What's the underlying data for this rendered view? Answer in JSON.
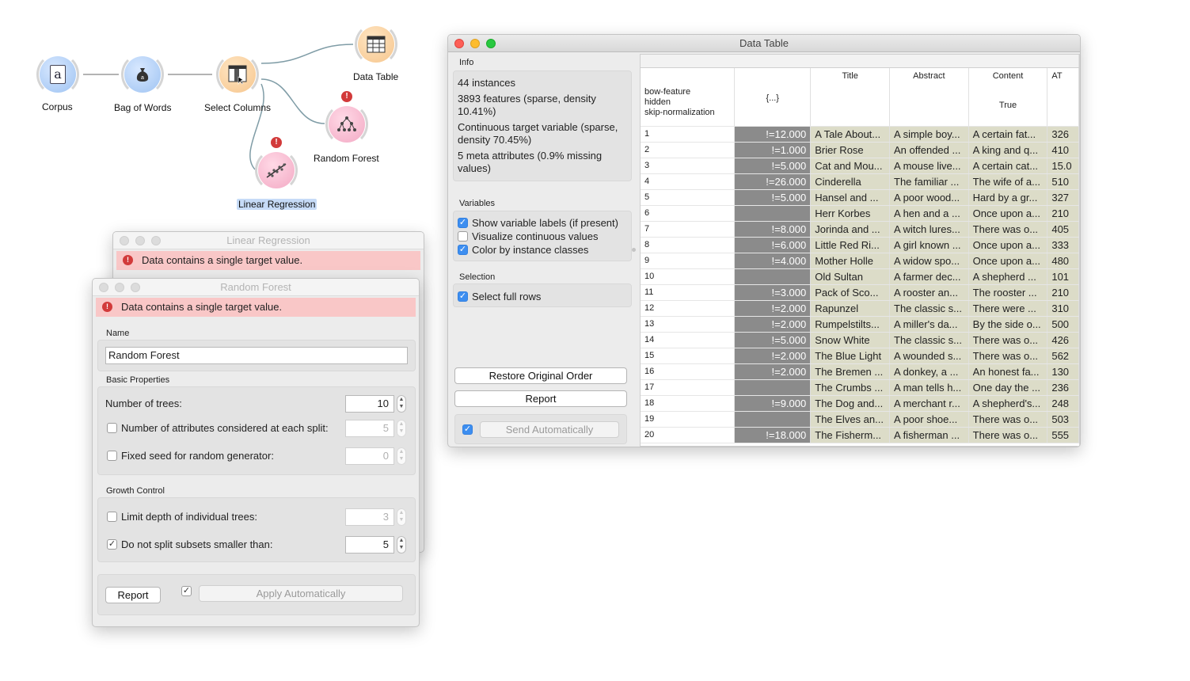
{
  "workflow": {
    "nodes": [
      {
        "label": "Corpus",
        "icon": "document-a-icon",
        "color": "blue"
      },
      {
        "label": "Bag of Words",
        "icon": "money-bag-icon",
        "color": "blue"
      },
      {
        "label": "Select Columns",
        "icon": "select-columns-icon",
        "color": "orange"
      },
      {
        "label": "Data Table",
        "icon": "table-icon",
        "color": "orange"
      },
      {
        "label": "Random Forest",
        "icon": "tree-icon",
        "color": "pink",
        "warning": "!"
      },
      {
        "label": "Linear Regression",
        "icon": "regression-icon",
        "color": "pink",
        "warning": "!"
      }
    ]
  },
  "linear_regression": {
    "title": "Linear Regression",
    "error": "Data contains a single target value."
  },
  "random_forest": {
    "title": "Random Forest",
    "error": "Data contains a single target value.",
    "name_label": "Name",
    "name_value": "Random Forest",
    "basic_label": "Basic Properties",
    "trees_label": "Number of trees:",
    "trees_value": "10",
    "attrs_label": "Number of attributes considered at each split:",
    "attrs_value": "5",
    "attrs_checked": false,
    "seed_label": "Fixed seed for random generator:",
    "seed_value": "0",
    "seed_checked": false,
    "growth_label": "Growth Control",
    "depth_label": "Limit depth of individual trees:",
    "depth_value": "3",
    "depth_checked": false,
    "split_label": "Do not split subsets smaller than:",
    "split_value": "5",
    "split_checked": true,
    "report_label": "Report",
    "apply_label": "Apply Automatically",
    "apply_checked": true
  },
  "data_table": {
    "title": "Data Table",
    "info_label": "Info",
    "info_lines": [
      "44 instances",
      "3893 features (sparse, density 10.41%)",
      "Continuous target variable (sparse, density 70.45%)",
      "5 meta attributes (0.9% missing values)"
    ],
    "variables_label": "Variables",
    "show_labels": "Show variable labels (if present)",
    "show_labels_checked": true,
    "visualize": "Visualize continuous values",
    "visualize_checked": false,
    "color_classes": "Color by instance classes",
    "color_classes_checked": true,
    "selection_label": "Selection",
    "select_rows": "Select full rows",
    "select_rows_checked": true,
    "restore_label": "Restore Original Order",
    "report_label": "Report",
    "send_label": "Send Automatically",
    "send_checked": true,
    "header_labels": [
      "bow-feature",
      "hidden",
      "skip-normalization"
    ],
    "columns": [
      "{...}",
      "Title",
      "Abstract",
      "Content",
      "AT"
    ],
    "content_sub": "True",
    "rows": [
      {
        "n": "1",
        "v": "!=12.000",
        "title": "A Tale About...",
        "abstract": "A simple boy...",
        "content": "A certain fat...",
        "at": "326"
      },
      {
        "n": "2",
        "v": "!=1.000",
        "title": "Brier Rose",
        "abstract": "An offended ...",
        "content": "A king and q...",
        "at": "410"
      },
      {
        "n": "3",
        "v": "!=5.000",
        "title": "Cat and Mou...",
        "abstract": "A mouse live...",
        "content": "A certain cat...",
        "at": "15.0"
      },
      {
        "n": "4",
        "v": "!=26.000",
        "title": "Cinderella",
        "abstract": "The familiar ...",
        "content": "The wife of a...",
        "at": "510"
      },
      {
        "n": "5",
        "v": "!=5.000",
        "title": "Hansel and ...",
        "abstract": "A poor wood...",
        "content": "Hard by a gr...",
        "at": "327"
      },
      {
        "n": "6",
        "v": "",
        "title": "Herr Korbes",
        "abstract": "A hen and a ...",
        "content": "Once upon a...",
        "at": "210"
      },
      {
        "n": "7",
        "v": "!=8.000",
        "title": "Jorinda and ...",
        "abstract": "A witch lures...",
        "content": "There was o...",
        "at": "405"
      },
      {
        "n": "8",
        "v": "!=6.000",
        "title": "Little Red Ri...",
        "abstract": "A girl known ...",
        "content": "Once upon a...",
        "at": "333"
      },
      {
        "n": "9",
        "v": "!=4.000",
        "title": "Mother Holle",
        "abstract": "A widow spo...",
        "content": "Once upon a...",
        "at": "480"
      },
      {
        "n": "10",
        "v": "",
        "title": "Old Sultan",
        "abstract": "A farmer dec...",
        "content": "A shepherd ...",
        "at": "101"
      },
      {
        "n": "11",
        "v": "!=3.000",
        "title": "Pack of Sco...",
        "abstract": "A rooster an...",
        "content": "The rooster ...",
        "at": "210"
      },
      {
        "n": "12",
        "v": "!=2.000",
        "title": "Rapunzel",
        "abstract": "The classic s...",
        "content": "There were ...",
        "at": "310"
      },
      {
        "n": "13",
        "v": "!=2.000",
        "title": "Rumpelstilts...",
        "abstract": "A miller's da...",
        "content": "By the side o...",
        "at": "500"
      },
      {
        "n": "14",
        "v": "!=5.000",
        "title": "Snow White",
        "abstract": "The classic s...",
        "content": "There was o...",
        "at": "426"
      },
      {
        "n": "15",
        "v": "!=2.000",
        "title": "The Blue Light",
        "abstract": "A wounded s...",
        "content": "There was o...",
        "at": "562"
      },
      {
        "n": "16",
        "v": "!=2.000",
        "title": "The Bremen ...",
        "abstract": "A donkey, a ...",
        "content": "An honest fa...",
        "at": "130"
      },
      {
        "n": "17",
        "v": "",
        "title": "The Crumbs ...",
        "abstract": "A man tells h...",
        "content": "One day the ...",
        "at": "236"
      },
      {
        "n": "18",
        "v": "!=9.000",
        "title": "The Dog and...",
        "abstract": "A merchant r...",
        "content": "A shepherd's...",
        "at": "248"
      },
      {
        "n": "19",
        "v": "",
        "title": "The Elves an...",
        "abstract": "A poor shoe...",
        "content": "There was o...",
        "at": "503"
      },
      {
        "n": "20",
        "v": "!=18.000",
        "title": "The Fisherm...",
        "abstract": "A fisherman ...",
        "content": "There was o...",
        "at": "555"
      }
    ]
  }
}
